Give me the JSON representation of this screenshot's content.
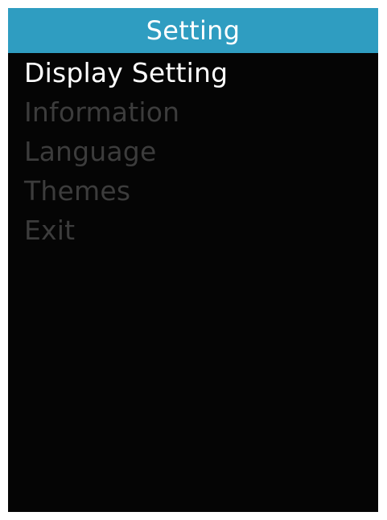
{
  "header": {
    "title": "Setting"
  },
  "menu": {
    "items": [
      {
        "label": "Display Setting",
        "selected": true
      },
      {
        "label": "Information",
        "selected": false
      },
      {
        "label": "Language",
        "selected": false
      },
      {
        "label": "Themes",
        "selected": false
      },
      {
        "label": "Exit",
        "selected": false
      }
    ]
  },
  "colors": {
    "header_bg": "#2f9dc1",
    "screen_bg": "#050505",
    "selected_text": "#ffffff",
    "unselected_text": "#3c3c3c"
  }
}
